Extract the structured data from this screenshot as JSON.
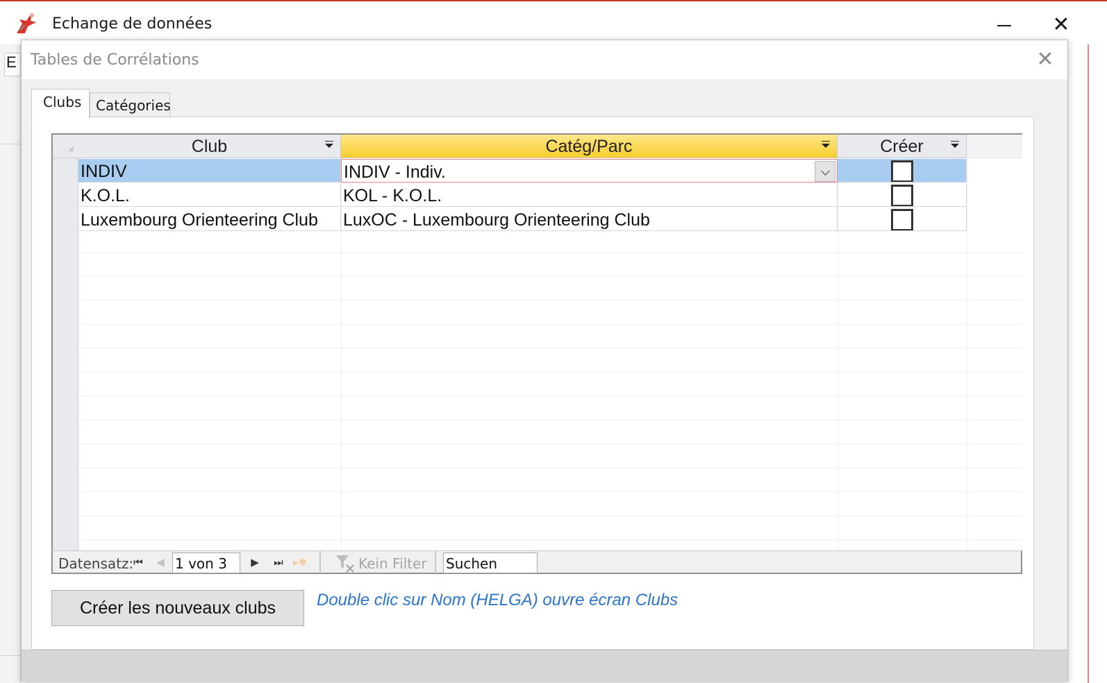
{
  "outer_window": {
    "title": "Echange de données",
    "menu_letter": "E"
  },
  "dialog": {
    "title": "Tables de Corrélations"
  },
  "tabs": [
    {
      "label": "Clubs",
      "active": true
    },
    {
      "label": "Catégories",
      "active": false
    }
  ],
  "datasheet": {
    "columns": [
      "Club",
      "Catég/Parc",
      "Créer"
    ],
    "rows": [
      {
        "club": "INDIV",
        "categ": "INDIV - Indiv.",
        "creer": false,
        "selected": true
      },
      {
        "club": "K.O.L.",
        "categ": "KOL - K.O.L.",
        "creer": false,
        "selected": false
      },
      {
        "club": "Luxembourg Orienteering Club",
        "categ": "LuxOC - Luxembourg Orienteering Club",
        "creer": false,
        "selected": false
      }
    ]
  },
  "navigation": {
    "label": "Datensatz:",
    "record": "1 von 3",
    "filter_label": "Kein Filter",
    "search_placeholder": "Suchen"
  },
  "actions": {
    "create_button": "Créer les nouveaux clubs",
    "hint": "Double clic sur Nom (HELGA) ouvre écran Clubs"
  },
  "colors": {
    "selected_row": "#a8cdf0",
    "active_header": "#fdd94e",
    "hint_text": "#2a74c9",
    "outer_accent": "#c0392b"
  }
}
